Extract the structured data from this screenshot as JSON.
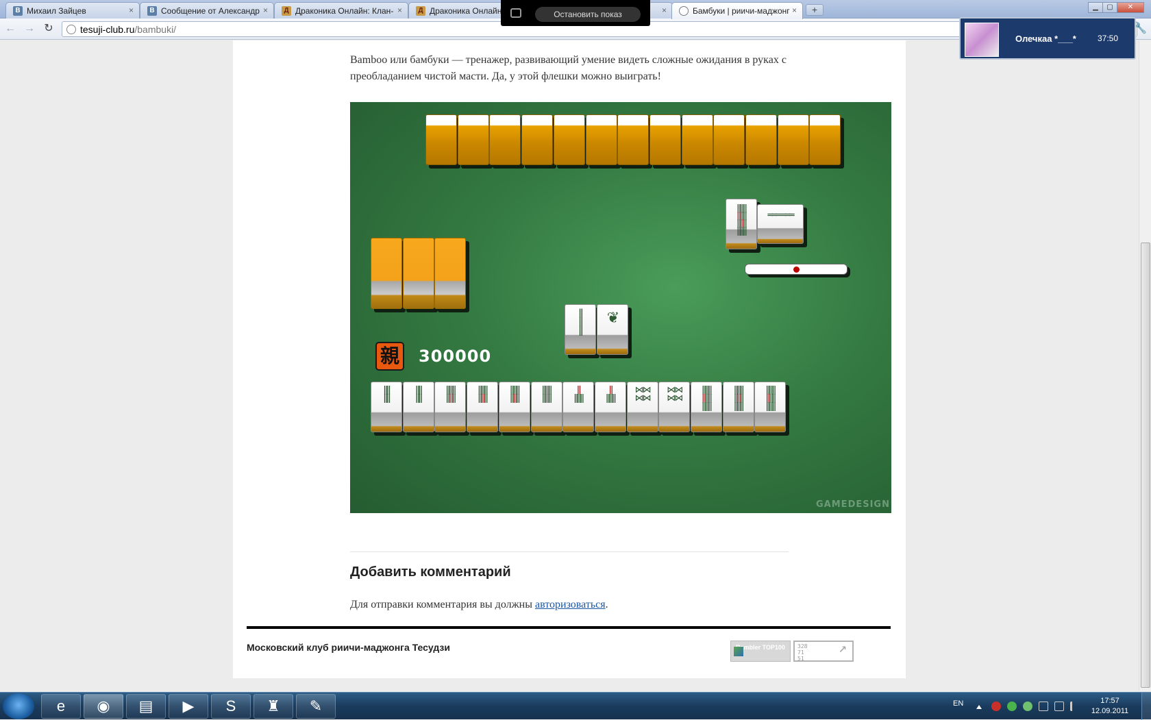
{
  "browser": {
    "tabs": [
      {
        "title": "Михаил Зайцев",
        "favicon": "vk-icon"
      },
      {
        "title": "Сообщение от Александр",
        "favicon": "vk-icon"
      },
      {
        "title": "Драконика Онлайн: Клан-",
        "favicon": "draconica-icon"
      },
      {
        "title": "Драконика Онлайн:",
        "favicon": "draconica-icon"
      },
      {
        "title": "Бамбуки | риичи-маджонг",
        "favicon": "globe-icon"
      }
    ],
    "new_tab_label": "+",
    "url_host": "tesuji-club.ru",
    "url_path": "/bambuki/"
  },
  "screen_share": {
    "stop_label": "Остановить показ"
  },
  "notification": {
    "name": "Олечкаа *___*",
    "time": "37:50"
  },
  "article": {
    "intro": "Bamboo или бамбуки — тренажер, развивающий умение видеть сложные ожидания в руках с преобладанием чистой масти. Да, у этой флешки можно выиграть!"
  },
  "game": {
    "dealer_symbol": "親",
    "score": "300000",
    "watermark": "GAMEDESIGN",
    "opponent_hidden_tiles": 13,
    "left_side_tiles": 3,
    "discard_tiles": 2,
    "hand_tiles": 13
  },
  "comments": {
    "title": "Добавить комментарий",
    "prefix": "Для отправки комментария вы должны ",
    "link": "авторизоваться",
    "suffix": "."
  },
  "footer": {
    "club_name": "Московский клуб риичи-маджонга Тесудзи",
    "rambler_label": "Rambler TOP100",
    "counter_lines": [
      "328",
      "71",
      "51"
    ]
  },
  "taskbar": {
    "language": "EN",
    "time": "17:57",
    "date": "12.09.2011"
  },
  "colors": {
    "table_green": "#347a42",
    "tile_back": "#c98600",
    "dealer_badge": "#e8590f",
    "link": "#1a56a6"
  }
}
